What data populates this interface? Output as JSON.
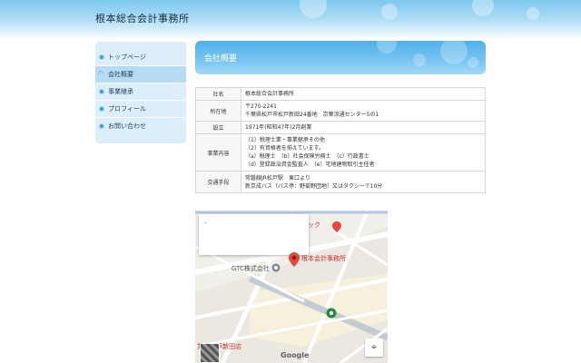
{
  "site": {
    "title": "根本総合会計事務所"
  },
  "sidebar": {
    "items": [
      {
        "label": "トップページ",
        "icon": "bullet-icon",
        "active": false
      },
      {
        "label": "会社概要",
        "icon": "open-bullet-icon",
        "active": true
      },
      {
        "label": "事業継承",
        "icon": "bullet-icon",
        "active": false
      },
      {
        "label": "プロフィール",
        "icon": "bullet-icon",
        "active": false
      },
      {
        "label": "お問い合わせ",
        "icon": "bullet-icon",
        "active": false
      }
    ]
  },
  "main": {
    "section_title": "会社概要",
    "table": [
      {
        "key": "社名",
        "lines": [
          "根本総合会計事務所"
        ]
      },
      {
        "key": "所在地",
        "lines": [
          "〒270-2241",
          "千葉県松戸市松戸新田24番地　京葉流通センター5の1"
        ]
      },
      {
        "key": "設立",
        "lines": [
          "1971年(昭和47年)2月創業"
        ]
      },
      {
        "key": "事業内容",
        "lines": [
          "（1）税理士業・事業継承その他",
          "（2）有資格者を揃えています。",
          "（a）税理士　（b）社会保険労務士　（c）行政書士",
          "（d）登録政治資金監査人　（e）宅地建物取引主任者"
        ]
      },
      {
        "key": "交通手段",
        "lines": [
          "常磐線JR松戸駅　東口より",
          "新京成バス（バス停：野菊野団地）又はタクシーで10分"
        ]
      }
    ]
  },
  "map": {
    "card_text": "·",
    "pin_label": "根本会計事務所",
    "gtc_label": "GTC株式会社",
    "shop_label": "業務松戸新田店",
    "partial_label": "ック",
    "attribution": "Google",
    "locate_icon": "crosshair-icon",
    "pin_color": "#e8453c",
    "green_marker_color": "#1e8e3e"
  }
}
